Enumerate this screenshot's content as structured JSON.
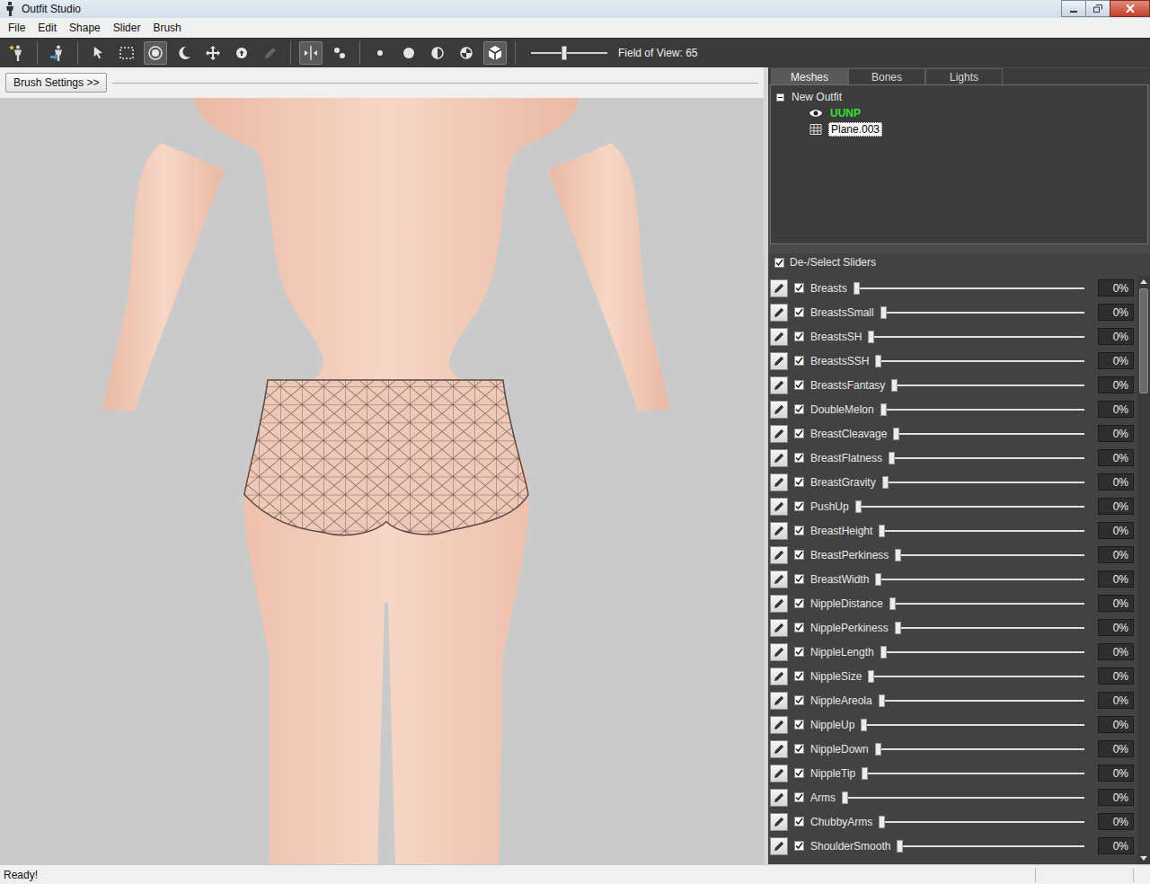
{
  "window": {
    "title": "Outfit Studio"
  },
  "menu": [
    "File",
    "Edit",
    "Shape",
    "Slider",
    "Brush"
  ],
  "toolbar": {
    "groups": [
      [
        {
          "selected": false,
          "disabled": false
        }
      ],
      [
        {
          "selected": false,
          "disabled": false
        }
      ],
      [
        {
          "selected": false,
          "disabled": false
        },
        {
          "selected": false,
          "disabled": false
        },
        {
          "selected": true,
          "disabled": false
        },
        {
          "selected": false,
          "disabled": false
        },
        {
          "selected": false,
          "disabled": false
        },
        {
          "selected": false,
          "disabled": false
        },
        {
          "selected": false,
          "disabled": true
        }
      ],
      [
        {
          "selected": true,
          "disabled": false
        },
        {
          "selected": false,
          "disabled": false
        }
      ],
      [
        {
          "selected": false,
          "disabled": false
        },
        {
          "selected": false,
          "disabled": false
        },
        {
          "selected": false,
          "disabled": false
        },
        {
          "selected": false,
          "disabled": false
        },
        {
          "selected": true,
          "disabled": false
        }
      ]
    ],
    "fov": {
      "label": "Field of View: 65",
      "level": 0.43
    }
  },
  "brush_settings": {
    "label": "Brush Settings >>"
  },
  "panel_tabs": [
    {
      "label": "Meshes",
      "selected": true
    },
    {
      "label": "Bones",
      "selected": false
    },
    {
      "label": "Lights",
      "selected": false
    }
  ],
  "mesh_tree": {
    "root": {
      "label": "New Outfit",
      "expanded": true
    },
    "items": [
      {
        "label": "UUNP",
        "kind": "reference",
        "selected": false
      },
      {
        "label": "Plane.003",
        "kind": "mesh",
        "selected": true
      }
    ]
  },
  "slider_header": {
    "label": "De-/Select Sliders",
    "checked": true
  },
  "sliders": [
    {
      "name": "Breasts",
      "checked": true,
      "level": 0,
      "value": "0%"
    },
    {
      "name": "BreastsSmall",
      "checked": true,
      "level": 0,
      "value": "0%"
    },
    {
      "name": "BreastsSH",
      "checked": true,
      "level": 0,
      "value": "0%"
    },
    {
      "name": "BreastsSSH",
      "checked": true,
      "level": 0,
      "value": "0%"
    },
    {
      "name": "BreastsFantasy",
      "checked": true,
      "level": 0,
      "value": "0%"
    },
    {
      "name": "DoubleMelon",
      "checked": true,
      "level": 0,
      "value": "0%"
    },
    {
      "name": "BreastCleavage",
      "checked": true,
      "level": 0,
      "value": "0%"
    },
    {
      "name": "BreastFlatness",
      "checked": true,
      "level": 0,
      "value": "0%"
    },
    {
      "name": "BreastGravity",
      "checked": true,
      "level": 0,
      "value": "0%"
    },
    {
      "name": "PushUp",
      "checked": true,
      "level": 0,
      "value": "0%"
    },
    {
      "name": "BreastHeight",
      "checked": true,
      "level": 0,
      "value": "0%"
    },
    {
      "name": "BreastPerkiness",
      "checked": true,
      "level": 0,
      "value": "0%"
    },
    {
      "name": "BreastWidth",
      "checked": true,
      "level": 0,
      "value": "0%"
    },
    {
      "name": "NippleDistance",
      "checked": true,
      "level": 0,
      "value": "0%"
    },
    {
      "name": "NipplePerkiness",
      "checked": true,
      "level": 0,
      "value": "0%"
    },
    {
      "name": "NippleLength",
      "checked": true,
      "level": 0,
      "value": "0%"
    },
    {
      "name": "NippleSize",
      "checked": true,
      "level": 0,
      "value": "0%"
    },
    {
      "name": "NippleAreola",
      "checked": true,
      "level": 0,
      "value": "0%"
    },
    {
      "name": "NippleUp",
      "checked": true,
      "level": 0,
      "value": "0%"
    },
    {
      "name": "NippleDown",
      "checked": true,
      "level": 0,
      "value": "0%"
    },
    {
      "name": "NippleTip",
      "checked": true,
      "level": 0,
      "value": "0%"
    },
    {
      "name": "Arms",
      "checked": true,
      "level": 0,
      "value": "0%"
    },
    {
      "name": "ChubbyArms",
      "checked": true,
      "level": 0,
      "value": "0%"
    },
    {
      "name": "ShoulderSmooth",
      "checked": true,
      "level": 0,
      "value": "0%"
    }
  ],
  "status_bar": {
    "text": "Ready!"
  }
}
